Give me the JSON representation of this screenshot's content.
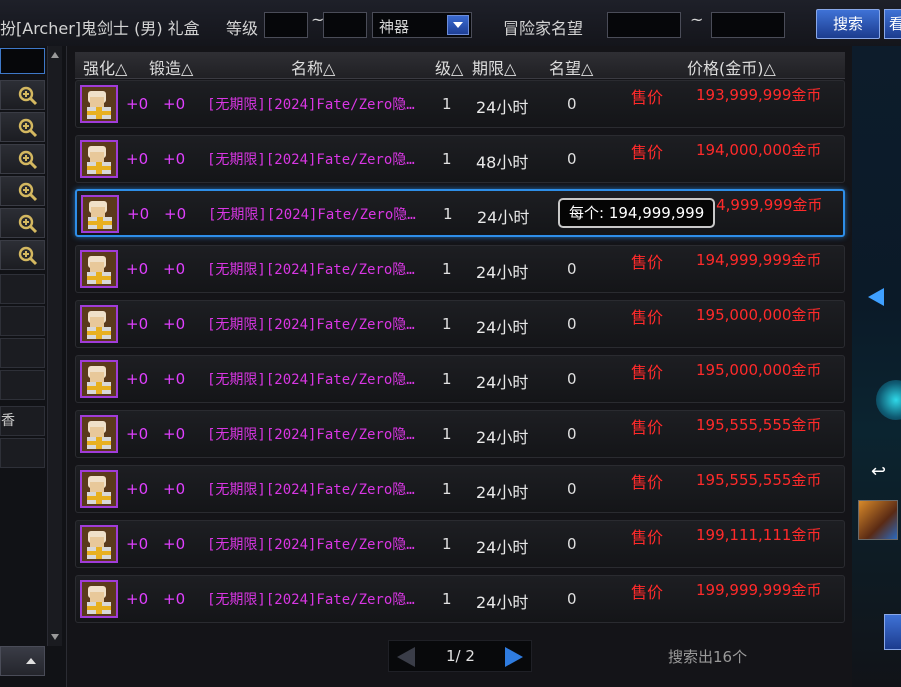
{
  "top_bar": {
    "item_name": "扮[Archer]鬼剑士 (男) 礼盒",
    "level_label": "等级",
    "level_min": "",
    "level_separator": "~",
    "level_max": "",
    "rarity_selected": "神器",
    "fame_label": "冒险家名望",
    "fame_min": "",
    "fame_separator": "~",
    "fame_max": "",
    "search_button": "搜索",
    "edge_button": "看"
  },
  "left_panel": {
    "partial_item_label": "香"
  },
  "table": {
    "headers": {
      "upgrade": "强化△",
      "forge": "锻造△",
      "name": "名称△",
      "level": "级△",
      "period": "期限△",
      "fame": "名望△",
      "price": "价格(金币)△"
    },
    "rows": [
      {
        "upgrade": "+0",
        "forge": "+0",
        "name": "[无期限][2024]Fate/Zero隐…",
        "level": "1",
        "period": "24小时",
        "fame": "0",
        "sell": "售价",
        "price": "193,999,999金币"
      },
      {
        "upgrade": "+0",
        "forge": "+0",
        "name": "[无期限][2024]Fate/Zero隐…",
        "level": "1",
        "period": "48小时",
        "fame": "0",
        "sell": "售价",
        "price": "194,000,000金币"
      },
      {
        "upgrade": "+0",
        "forge": "+0",
        "name": "[无期限][2024]Fate/Zero隐…",
        "level": "1",
        "period": "24小时",
        "fame": "0",
        "sell": "售价",
        "price": "194,999,999金币"
      },
      {
        "upgrade": "+0",
        "forge": "+0",
        "name": "[无期限][2024]Fate/Zero隐…",
        "level": "1",
        "period": "24小时",
        "fame": "0",
        "sell": "售价",
        "price": "194,999,999金币"
      },
      {
        "upgrade": "+0",
        "forge": "+0",
        "name": "[无期限][2024]Fate/Zero隐…",
        "level": "1",
        "period": "24小时",
        "fame": "0",
        "sell": "售价",
        "price": "195,000,000金币"
      },
      {
        "upgrade": "+0",
        "forge": "+0",
        "name": "[无期限][2024]Fate/Zero隐…",
        "level": "1",
        "period": "24小时",
        "fame": "0",
        "sell": "售价",
        "price": "195,000,000金币"
      },
      {
        "upgrade": "+0",
        "forge": "+0",
        "name": "[无期限][2024]Fate/Zero隐…",
        "level": "1",
        "period": "24小时",
        "fame": "0",
        "sell": "售价",
        "price": "195,555,555金币"
      },
      {
        "upgrade": "+0",
        "forge": "+0",
        "name": "[无期限][2024]Fate/Zero隐…",
        "level": "1",
        "period": "24小时",
        "fame": "0",
        "sell": "售价",
        "price": "195,555,555金币"
      },
      {
        "upgrade": "+0",
        "forge": "+0",
        "name": "[无期限][2024]Fate/Zero隐…",
        "level": "1",
        "period": "24小时",
        "fame": "0",
        "sell": "售价",
        "price": "199,111,111金币"
      },
      {
        "upgrade": "+0",
        "forge": "+0",
        "name": "[无期限][2024]Fate/Zero隐…",
        "level": "1",
        "period": "24小时",
        "fame": "0",
        "sell": "售价",
        "price": "199,999,999金币"
      }
    ],
    "selected_row_index": 2
  },
  "tooltip": {
    "text": "每个: 194,999,999"
  },
  "pagination": {
    "text": "1/ 2"
  },
  "result_count": "搜索出16个",
  "colors": {
    "name_text": "#d936e4",
    "enhance_text": "#e040ff",
    "price_text": "#ff2a2a",
    "selected_border": "#2e8ee8",
    "button_blue": "#2c5bc0"
  },
  "icons": {
    "zoom": "magnifier-plus-icon",
    "item": "gift-box-item-icon",
    "page_prev": "triangle-left-icon",
    "page_next": "triangle-right-icon"
  }
}
